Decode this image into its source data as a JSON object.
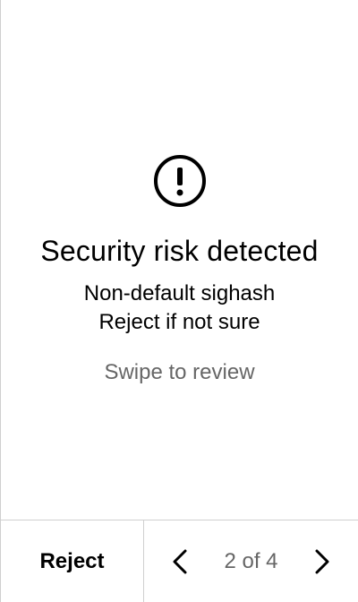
{
  "warning": {
    "icon": "exclamation-circle-icon",
    "title": "Security risk detected",
    "subtitle_line1": "Non-default sighash",
    "subtitle_line2": "Reject if not sure",
    "hint": "Swipe to review"
  },
  "footer": {
    "reject_label": "Reject",
    "page_indicator": "2 of 4",
    "prev_icon": "chevron-left-icon",
    "next_icon": "chevron-right-icon"
  },
  "colors": {
    "text": "#000000",
    "muted": "#666666",
    "divider": "#cfcfcf",
    "background": "#ffffff"
  }
}
